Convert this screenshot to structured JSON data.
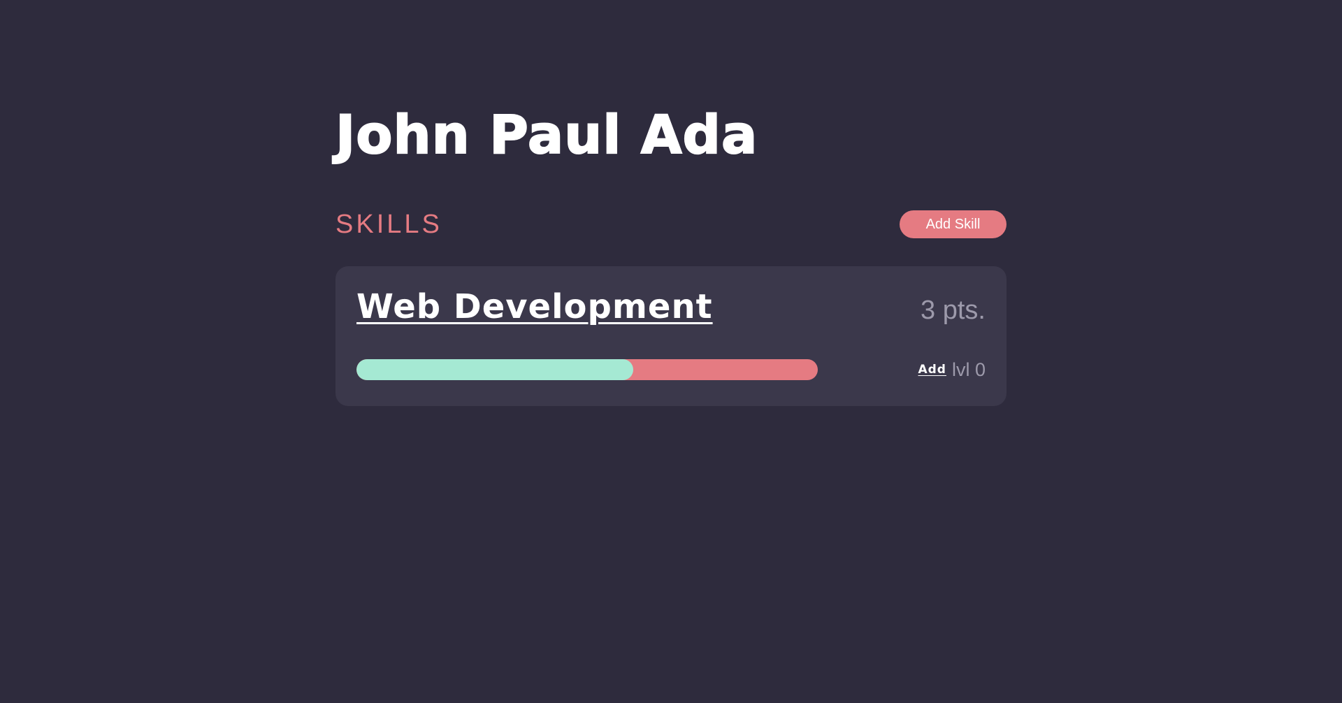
{
  "profile": {
    "name": "John Paul Ada"
  },
  "skills_section": {
    "title": "SKILLS",
    "add_button_label": "Add Skill"
  },
  "skills": [
    {
      "name": "Web Development",
      "points": "3 pts.",
      "progress_fraction": 0.6,
      "add_level_label": "Add",
      "level_text": "lvl 0"
    }
  ],
  "colors": {
    "background": "#2e2b3d",
    "card": "#3b384b",
    "accent": "#e57b82",
    "progress_fill": "#a5e9d3",
    "muted_text": "#9d9aab"
  }
}
